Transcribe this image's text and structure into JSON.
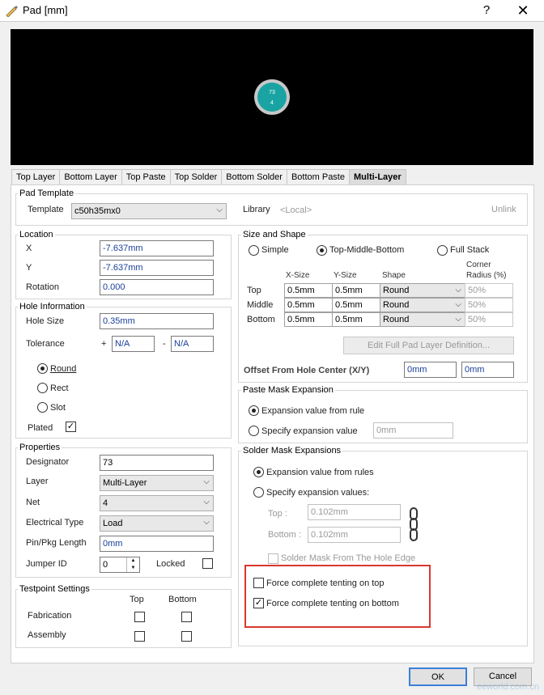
{
  "window": {
    "title": "Pad [mm]",
    "help": "?",
    "close": "✕"
  },
  "preview": {
    "pad_number": "73",
    "pad_net": "4",
    "pad_color": "#1aa3a3"
  },
  "tabs": [
    "Top Layer",
    "Bottom Layer",
    "Top Paste",
    "Top Solder",
    "Bottom Solder",
    "Bottom Paste",
    "Multi-Layer"
  ],
  "pad_template": {
    "title": "Pad Template",
    "template_label": "Template",
    "template_value": "c50h35mx0",
    "library_label": "Library",
    "library_value": "<Local>",
    "unlink": "Unlink"
  },
  "location": {
    "title": "Location",
    "x_label": "X",
    "x_value": "-7.637mm",
    "y_label": "Y",
    "y_value": "-7.637mm",
    "rotation_label": "Rotation",
    "rotation_value": "0.000"
  },
  "hole": {
    "title": "Hole Information",
    "size_label": "Hole Size",
    "size_value": "0.35mm",
    "tolerance_label": "Tolerance",
    "plus": "+",
    "plus_value": "N/A",
    "minus": "-",
    "minus_value": "N/A",
    "round": "Round",
    "rect": "Rect",
    "slot": "Slot",
    "plated_label": "Plated"
  },
  "properties": {
    "title": "Properties",
    "designator_label": "Designator",
    "designator_value": "73",
    "layer_label": "Layer",
    "layer_value": "Multi-Layer",
    "net_label": "Net",
    "net_value": "4",
    "etype_label": "Electrical Type",
    "etype_value": "Load",
    "pinpkg_label": "Pin/Pkg Length",
    "pinpkg_value": "0mm",
    "jumper_label": "Jumper ID",
    "jumper_value": "0",
    "locked_label": "Locked"
  },
  "testpoint": {
    "title": "Testpoint Settings",
    "top": "Top",
    "bottom": "Bottom",
    "fabrication": "Fabrication",
    "assembly": "Assembly"
  },
  "size_shape": {
    "title": "Size and Shape",
    "simple": "Simple",
    "tmb": "Top-Middle-Bottom",
    "full": "Full Stack",
    "headers": {
      "xsize": "X-Size",
      "ysize": "Y-Size",
      "shape": "Shape",
      "corner1": "Corner",
      "corner2": "Radius (%)"
    },
    "rows": [
      {
        "name": "Top",
        "x": "0.5mm",
        "y": "0.5mm",
        "shape": "Round",
        "corner": "50%"
      },
      {
        "name": "Middle",
        "x": "0.5mm",
        "y": "0.5mm",
        "shape": "Round",
        "corner": "50%"
      },
      {
        "name": "Bottom",
        "x": "0.5mm",
        "y": "0.5mm",
        "shape": "Round",
        "corner": "50%"
      }
    ],
    "edit_button": "Edit Full Pad Layer Definition...",
    "offset_label": "Offset From Hole Center (X/Y)",
    "offset_x": "0mm",
    "offset_y": "0mm"
  },
  "paste_mask": {
    "title": "Paste Mask Expansion",
    "from_rule": "Expansion value from rule",
    "specify": "Specify expansion value",
    "specify_value": "0mm"
  },
  "solder_mask": {
    "title": "Solder Mask Expansions",
    "from_rules": "Expansion value from rules",
    "specify": "Specify expansion values:",
    "top_label": "Top :",
    "top_value": "0.102mm",
    "bottom_label": "Bottom :",
    "bottom_value": "0.102mm",
    "from_hole": "Solder Mask From The Hole Edge",
    "tent_top": "Force complete tenting on top",
    "tent_bottom": "Force complete tenting on bottom"
  },
  "buttons": {
    "ok": "OK",
    "cancel": "Cancel"
  },
  "watermark": "eeworld.com.cn"
}
